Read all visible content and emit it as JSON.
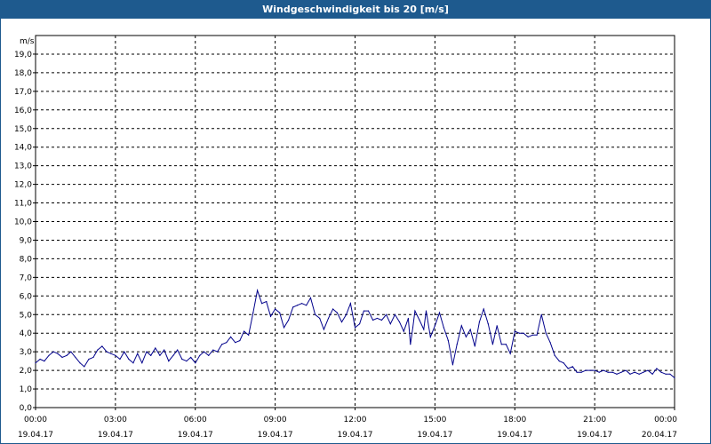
{
  "window": {
    "title": "Windgeschwindigkeit bis 20 [m/s]"
  },
  "colors": {
    "titlebar": "#1e5a8e",
    "line": "#00008b",
    "grid": "#000000"
  },
  "chart_data": {
    "type": "line",
    "title": "Windgeschwindigkeit bis 20 [m/s]",
    "ylabel": "m/s",
    "ylim": [
      0,
      20
    ],
    "y_ticks": [
      "0,0",
      "1,0",
      "2,0",
      "3,0",
      "4,0",
      "5,0",
      "6,0",
      "7,0",
      "8,0",
      "9,0",
      "10,0",
      "11,0",
      "12,0",
      "13,0",
      "14,0",
      "15,0",
      "16,0",
      "17,0",
      "18,0",
      "19,0"
    ],
    "x_range_hours": [
      0,
      24
    ],
    "grid": true,
    "x_ticks": [
      {
        "time": "00:00",
        "date": "19.04.17",
        "hour": 0
      },
      {
        "time": "03:00",
        "date": "19.04.17",
        "hour": 3
      },
      {
        "time": "06:00",
        "date": "19.04.17",
        "hour": 6
      },
      {
        "time": "09:00",
        "date": "19.04.17",
        "hour": 9
      },
      {
        "time": "12:00",
        "date": "19.04.17",
        "hour": 12
      },
      {
        "time": "15:00",
        "date": "19.04.17",
        "hour": 15
      },
      {
        "time": "18:00",
        "date": "19.04.17",
        "hour": 18
      },
      {
        "time": "21:00",
        "date": "19.04.17",
        "hour": 21
      },
      {
        "time": "00:00",
        "date": "20.04.17",
        "hour": 24
      }
    ],
    "series": [
      {
        "color": "#00008b",
        "points": [
          [
            0.0,
            2.4
          ],
          [
            0.17,
            2.6
          ],
          [
            0.33,
            2.5
          ],
          [
            0.5,
            2.8
          ],
          [
            0.67,
            3.0
          ],
          [
            0.83,
            2.9
          ],
          [
            1.0,
            2.7
          ],
          [
            1.17,
            2.8
          ],
          [
            1.33,
            3.0
          ],
          [
            1.5,
            2.7
          ],
          [
            1.67,
            2.4
          ],
          [
            1.83,
            2.2
          ],
          [
            2.0,
            2.6
          ],
          [
            2.17,
            2.7
          ],
          [
            2.33,
            3.1
          ],
          [
            2.5,
            3.3
          ],
          [
            2.67,
            3.0
          ],
          [
            2.83,
            2.9
          ],
          [
            3.0,
            2.8
          ],
          [
            3.17,
            2.6
          ],
          [
            3.33,
            3.0
          ],
          [
            3.5,
            2.6
          ],
          [
            3.67,
            2.4
          ],
          [
            3.83,
            2.9
          ],
          [
            4.0,
            2.4
          ],
          [
            4.17,
            3.0
          ],
          [
            4.33,
            2.8
          ],
          [
            4.5,
            3.2
          ],
          [
            4.67,
            2.8
          ],
          [
            4.83,
            3.1
          ],
          [
            5.0,
            2.5
          ],
          [
            5.17,
            2.8
          ],
          [
            5.33,
            3.1
          ],
          [
            5.5,
            2.6
          ],
          [
            5.67,
            2.5
          ],
          [
            5.83,
            2.7
          ],
          [
            6.0,
            2.4
          ],
          [
            6.17,
            2.8
          ],
          [
            6.33,
            3.0
          ],
          [
            6.5,
            2.8
          ],
          [
            6.67,
            3.1
          ],
          [
            6.83,
            3.0
          ],
          [
            7.0,
            3.4
          ],
          [
            7.17,
            3.5
          ],
          [
            7.33,
            3.8
          ],
          [
            7.5,
            3.5
          ],
          [
            7.67,
            3.6
          ],
          [
            7.83,
            4.1
          ],
          [
            8.0,
            3.9
          ],
          [
            8.17,
            5.1
          ],
          [
            8.33,
            6.3
          ],
          [
            8.5,
            5.6
          ],
          [
            8.67,
            5.7
          ],
          [
            8.83,
            4.9
          ],
          [
            9.0,
            5.3
          ],
          [
            9.17,
            5.1
          ],
          [
            9.33,
            4.3
          ],
          [
            9.5,
            4.7
          ],
          [
            9.67,
            5.4
          ],
          [
            9.83,
            5.5
          ],
          [
            10.0,
            5.6
          ],
          [
            10.17,
            5.5
          ],
          [
            10.33,
            5.9
          ],
          [
            10.5,
            5.0
          ],
          [
            10.67,
            4.8
          ],
          [
            10.83,
            4.2
          ],
          [
            11.0,
            4.8
          ],
          [
            11.17,
            5.3
          ],
          [
            11.33,
            5.1
          ],
          [
            11.5,
            4.6
          ],
          [
            11.67,
            5.0
          ],
          [
            11.83,
            5.6
          ],
          [
            12.0,
            4.3
          ],
          [
            12.17,
            4.5
          ],
          [
            12.33,
            5.2
          ],
          [
            12.5,
            5.2
          ],
          [
            12.67,
            4.7
          ],
          [
            12.83,
            4.8
          ],
          [
            13.0,
            4.7
          ],
          [
            13.17,
            5.0
          ],
          [
            13.33,
            4.5
          ],
          [
            13.5,
            5.0
          ],
          [
            13.67,
            4.6
          ],
          [
            13.83,
            4.1
          ],
          [
            14.0,
            4.8
          ],
          [
            14.08,
            3.4
          ],
          [
            14.17,
            4.3
          ],
          [
            14.25,
            5.2
          ],
          [
            14.42,
            4.7
          ],
          [
            14.58,
            4.2
          ],
          [
            14.67,
            5.2
          ],
          [
            14.83,
            3.8
          ],
          [
            15.0,
            4.4
          ],
          [
            15.17,
            5.1
          ],
          [
            15.33,
            4.3
          ],
          [
            15.5,
            3.6
          ],
          [
            15.67,
            2.3
          ],
          [
            15.83,
            3.4
          ],
          [
            16.0,
            4.4
          ],
          [
            16.17,
            3.8
          ],
          [
            16.33,
            4.2
          ],
          [
            16.5,
            3.3
          ],
          [
            16.67,
            4.6
          ],
          [
            16.83,
            5.3
          ],
          [
            17.0,
            4.5
          ],
          [
            17.17,
            3.4
          ],
          [
            17.33,
            4.4
          ],
          [
            17.5,
            3.4
          ],
          [
            17.67,
            3.4
          ],
          [
            17.83,
            2.9
          ],
          [
            18.0,
            4.1
          ],
          [
            18.17,
            4.0
          ],
          [
            18.33,
            4.0
          ],
          [
            18.5,
            3.8
          ],
          [
            18.67,
            3.9
          ],
          [
            18.83,
            3.9
          ],
          [
            19.0,
            5.0
          ],
          [
            19.17,
            4.0
          ],
          [
            19.33,
            3.5
          ],
          [
            19.5,
            2.8
          ],
          [
            19.67,
            2.5
          ],
          [
            19.83,
            2.4
          ],
          [
            20.0,
            2.1
          ],
          [
            20.17,
            2.2
          ],
          [
            20.33,
            1.9
          ],
          [
            20.5,
            1.9
          ],
          [
            20.67,
            2.0
          ],
          [
            20.83,
            2.0
          ],
          [
            21.0,
            2.0
          ],
          [
            21.17,
            1.9
          ],
          [
            21.33,
            2.0
          ],
          [
            21.5,
            1.9
          ],
          [
            21.67,
            1.9
          ],
          [
            21.83,
            1.8
          ],
          [
            22.0,
            1.9
          ],
          [
            22.17,
            2.0
          ],
          [
            22.33,
            1.8
          ],
          [
            22.5,
            1.9
          ],
          [
            22.67,
            1.8
          ],
          [
            22.83,
            1.9
          ],
          [
            23.0,
            2.0
          ],
          [
            23.17,
            1.8
          ],
          [
            23.33,
            2.1
          ],
          [
            23.5,
            1.9
          ],
          [
            23.67,
            1.8
          ],
          [
            23.83,
            1.8
          ],
          [
            24.0,
            1.6
          ]
        ]
      }
    ]
  }
}
